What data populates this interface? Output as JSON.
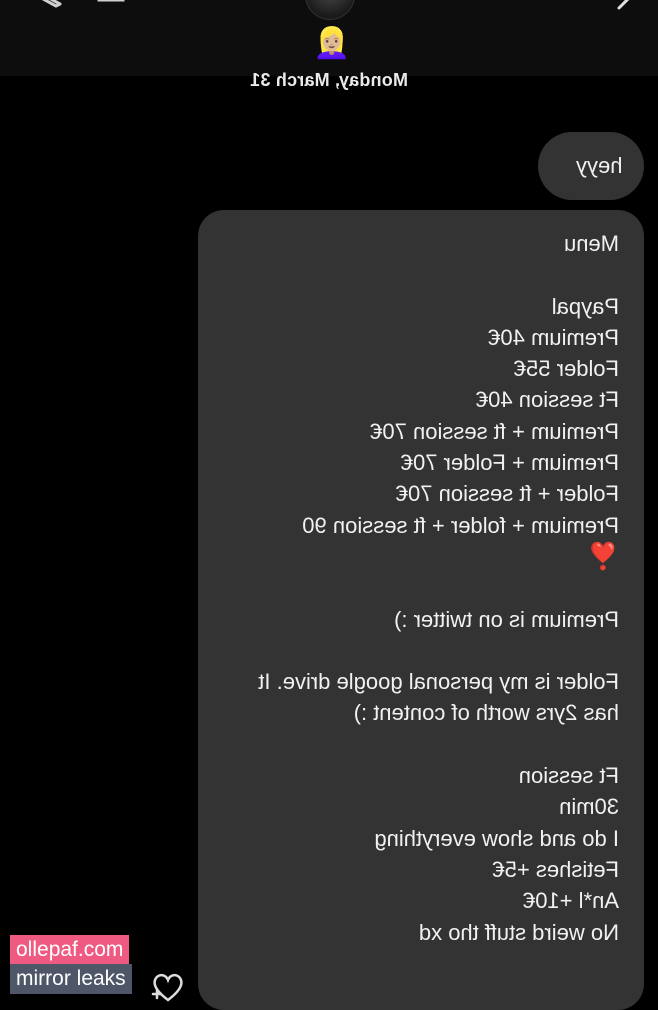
{
  "header": {
    "date_label": "Monday, March 31",
    "emoji": "👱🏼‍♀️",
    "icons": [
      "pencil-icon",
      "square-icon",
      "chevron-icon",
      "avatar"
    ]
  },
  "messages": [
    {
      "id": "m1",
      "text": "heyy"
    },
    {
      "id": "m2",
      "lines": [
        "Menu",
        "",
        "Paypal",
        "Premium 40€",
        "Folder 55€",
        "Ft session 40€",
        "Premium + ft session 70€",
        "Premium + Folder 70€",
        "Folder + ft session 70€",
        "Premium + folder + ft session 90",
        "❣️",
        "",
        "Premium is on twitter :)",
        "",
        "Folder is my personal google drive. It has 2yrs worth of content :)",
        "",
        "Ft session",
        "30min",
        "I do and show everything",
        "Fetishes +5€",
        "An*l +10€",
        "No weird stuff tho xd"
      ]
    }
  ],
  "watermark": {
    "line1": "ollepaf.com",
    "line2": "mirror leaks"
  },
  "colors": {
    "background": "#000000",
    "bubble": "#333333",
    "text": "#f1f1f1",
    "watermark_pink": "#ef5a82",
    "watermark_gray": "#4e5668"
  }
}
